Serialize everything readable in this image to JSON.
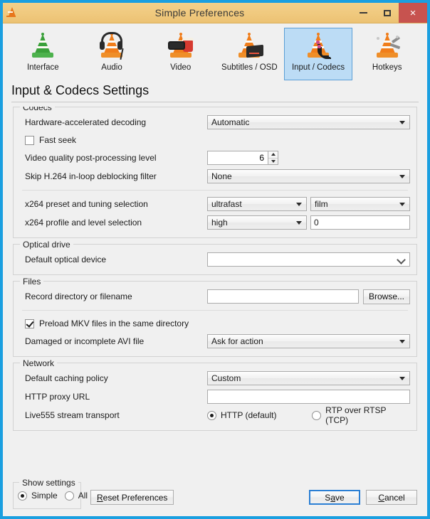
{
  "window": {
    "title": "Simple Preferences",
    "app_icon": "vlc-cone-icon",
    "controls": {
      "minimize": "minimize-icon",
      "maximize": "maximize-icon",
      "close": "×"
    }
  },
  "tabs": [
    {
      "label": "Interface",
      "icon": "vlc-cone-green-icon",
      "selected": false
    },
    {
      "label": "Audio",
      "icon": "vlc-cone-headphones-icon",
      "selected": false
    },
    {
      "label": "Video",
      "icon": "vlc-cone-glasses-popcorn-icon",
      "selected": false
    },
    {
      "label": "Subtitles / OSD",
      "icon": "vlc-cone-screen-icon",
      "selected": false
    },
    {
      "label": "Input / Codecs",
      "icon": "vlc-cone-cables-icon",
      "selected": true
    },
    {
      "label": "Hotkeys",
      "icon": "vlc-cone-tools-icon",
      "selected": false
    }
  ],
  "page": {
    "title": "Input & Codecs Settings"
  },
  "groups": {
    "codecs": {
      "title": "Codecs",
      "hw_decoding": {
        "label": "Hardware-accelerated decoding",
        "value": "Automatic"
      },
      "fast_seek": {
        "label": "Fast seek",
        "checked": false
      },
      "postproc": {
        "label": "Video quality post-processing level",
        "value": "6"
      },
      "skip_loop": {
        "label": "Skip H.264 in-loop deblocking filter",
        "value": "None"
      },
      "x264_preset": {
        "label": "x264 preset and tuning selection",
        "preset": "ultrafast",
        "tuning": "film"
      },
      "x264_profile": {
        "label": "x264 profile and level selection",
        "profile": "high",
        "level": "0"
      }
    },
    "optical": {
      "title": "Optical drive",
      "default_device": {
        "label": "Default optical device",
        "value": ""
      }
    },
    "files": {
      "title": "Files",
      "record_dir": {
        "label": "Record directory or filename",
        "value": "",
        "browse_label": "Browse..."
      },
      "preload_mkv": {
        "label": "Preload MKV files in the same directory",
        "checked": true
      },
      "damaged_avi": {
        "label": "Damaged or incomplete AVI file",
        "value": "Ask for action"
      }
    },
    "network": {
      "title": "Network",
      "caching": {
        "label": "Default caching policy",
        "value": "Custom"
      },
      "proxy": {
        "label": "HTTP proxy URL",
        "value": ""
      },
      "live555": {
        "label": "Live555 stream transport",
        "options": [
          {
            "label": "HTTP (default)",
            "selected": true
          },
          {
            "label": "RTP over RTSP (TCP)",
            "selected": false
          }
        ]
      }
    }
  },
  "footer": {
    "show_settings": {
      "title": "Show settings",
      "options": [
        {
          "label": "Simple",
          "selected": true
        },
        {
          "label": "All",
          "selected": false
        }
      ]
    },
    "reset": {
      "prefix": "R",
      "rest": "eset Preferences"
    },
    "save": {
      "prefix": "S",
      "accel": "a",
      "rest": "ve"
    },
    "cancel": {
      "prefix": "",
      "accel": "C",
      "rest": "ancel"
    }
  },
  "colors": {
    "window_border": "#1a9fe0",
    "titlebar": "#f0c97e",
    "close_button": "#c7534f",
    "selected_tab_bg": "#bcdcf5",
    "selected_tab_border": "#5a9ed6",
    "client_bg": "#f0f0f0",
    "default_button_border": "#2b7fd4"
  }
}
